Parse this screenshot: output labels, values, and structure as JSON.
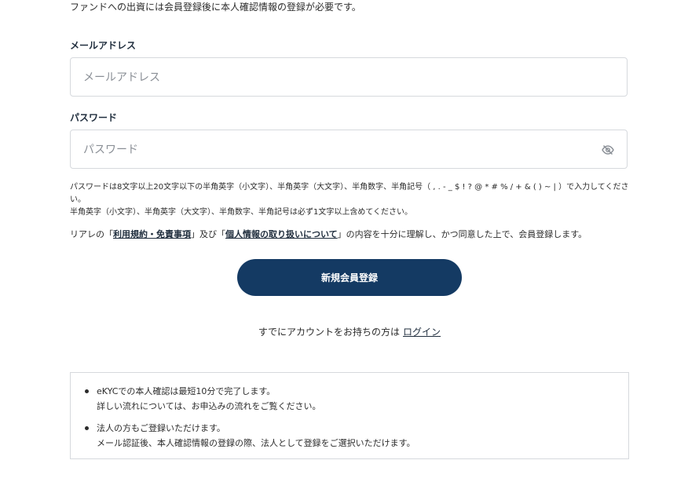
{
  "intro_text": "ファンドへの出資には会員登録後に本人確認情報の登録が必要です。",
  "email": {
    "label": "メールアドレス",
    "placeholder": "メールアドレス",
    "value": ""
  },
  "password": {
    "label": "パスワード",
    "placeholder": "パスワード",
    "value": "",
    "toggle_icon": "eye-off-icon"
  },
  "password_hint": {
    "line1": "パスワードは8文字以上20文字以下の半角英字（小文字）、半角英字（大文字）、半角数字、半角記号（ , . - _ $ ! ? @ * # % / + & ( ) ~ | ）で入力してください。",
    "line2": "半角英字（小文字）、半角英字（大文字）、半角数字、半角記号は必ず1文字以上含めてください。"
  },
  "terms": {
    "prefix": "リアレの「",
    "link1": "利用規約・免責事項",
    "middle": "」及び「",
    "link2": "個人情報の取り扱いについて",
    "suffix": "」の内容を十分に理解し、かつ同意した上で、会員登録します。"
  },
  "register_button_label": "新規会員登録",
  "login": {
    "prompt": "すでにアカウントをお持ちの方は",
    "link": "ログイン"
  },
  "info": {
    "item1_line1": "eKYCでの本人確認は最短10分で完了します。",
    "item1_line2": "詳しい流れについては、お申込みの流れをご覧ください。",
    "item2_line1": "法人の方もご登録いただけます。",
    "item2_line2": "メール認証後、本人確認情報の登録の際、法人として登録をご選択いただけます。"
  },
  "colors": {
    "primary_button": "#143a63",
    "border": "#d6d9dd",
    "text": "#2b2b2b"
  }
}
